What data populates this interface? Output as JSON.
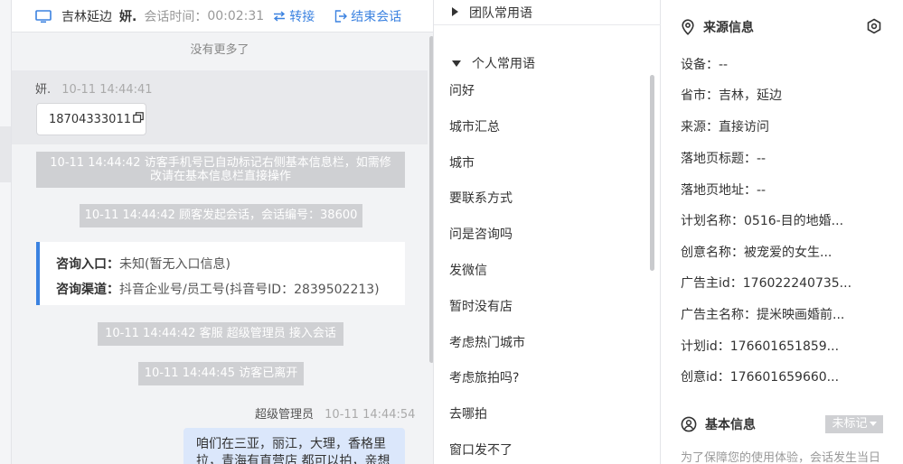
{
  "header": {
    "visitor_location": "吉林延边",
    "visitor_nick": "妍.",
    "session_time_label": "会话时间：",
    "session_time_value": "00:02:31",
    "transfer_label": "转接",
    "end_label": "结束会话"
  },
  "chat": {
    "no_more": "没有更多了",
    "visitor_msg": {
      "sender": "妍.",
      "timestamp": "10-11 14:44:41",
      "text": "18704333011"
    },
    "system_messages": [
      "10-11 14:44:42 访客手机号已自动标记右侧基本信息栏，如需修改请在基本信息栏直接操作",
      "10-11 14:44:42 顾客发起会话，会话编号：38600",
      "10-11 14:44:42 客服 超级管理员 接入会话",
      "10-11 14:44:45 访客已离开"
    ],
    "consult": {
      "entry_label": "咨询入口：",
      "entry_value": "未知(暂无入口信息)",
      "channel_label": "咨询渠道：",
      "channel_value": "抖音企业号/员工号(抖音号ID：2839502213)"
    },
    "agent_msg": {
      "sender": "超级管理员",
      "timestamp": "10-11 14:44:54",
      "text": "咱们在三亚，丽江，大理，香格里拉，青海有直营店 都可以拍，亲想"
    }
  },
  "phrases": {
    "team_label": "团队常用语",
    "personal_label": "个人常用语",
    "items": [
      "问好",
      "城市汇总",
      "城市",
      "要联系方式",
      "问是咨询吗",
      "发微信",
      "暂时没有店",
      "考虑热门城市",
      "考虑旅拍吗?",
      "去哪拍",
      "窗口发不了"
    ]
  },
  "info": {
    "source_title": "来源信息",
    "rows": [
      "设备：--",
      "省市：吉林，延边",
      "来源：直接访问",
      "落地页标题：--",
      "落地页地址：--",
      "计划名称：0516-目的地婚...",
      "创意名称：被宠爱的女生...",
      "广告主id：176022240735...",
      "广告主名称：提米映画婚前...",
      "计划id：176601651859...",
      "创意id：176601659660..."
    ],
    "basic_title": "基本信息",
    "tag_label": "未标记",
    "hint": "为了保障您的使用体验，会话发生当日"
  },
  "colors": {
    "accent": "#3b82e0",
    "system_msg_bg": "#cfd0d3",
    "agent_bubble_bg": "#dbe7fb"
  },
  "icons": {
    "monitor": "monitor-icon",
    "transfer": "transfer-icon",
    "end": "exit-icon",
    "copy": "copy-icon",
    "location": "location-pin-icon",
    "settings": "hexagon-settings-icon",
    "user": "user-circle-icon"
  }
}
